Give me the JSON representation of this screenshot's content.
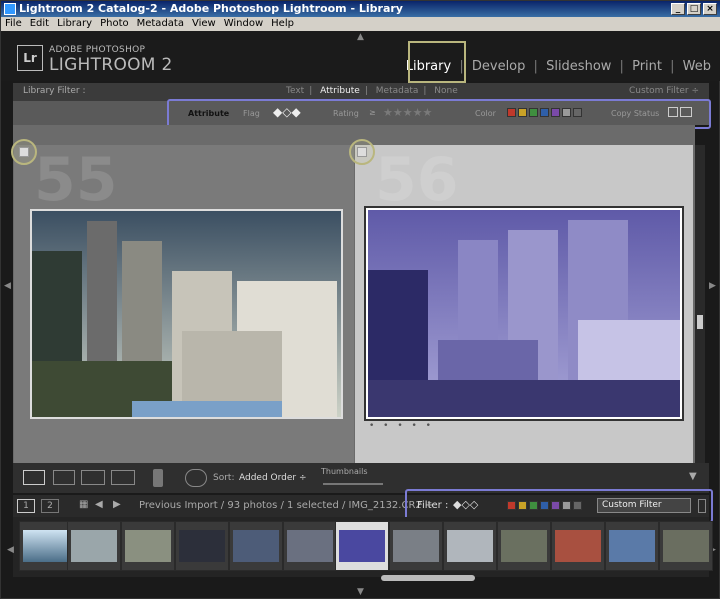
{
  "window": {
    "title": "Lightroom 2 Catalog-2 - Adobe Photoshop Lightroom - Library",
    "min": "_",
    "max": "□",
    "close": "×"
  },
  "menu": [
    "File",
    "Edit",
    "Library",
    "Photo",
    "Metadata",
    "View",
    "Window",
    "Help"
  ],
  "brand": {
    "logo": "Lr",
    "line1": "ADOBE PHOTOSHOP",
    "line2": "LIGHTROOM 2"
  },
  "modules": [
    "Library",
    "Develop",
    "Slideshow",
    "Print",
    "Web"
  ],
  "library_filter": {
    "label": "Library Filter :",
    "options": [
      "Text",
      "Attribute",
      "Metadata",
      "None"
    ],
    "active": "Attribute",
    "custom": "Custom Filter ÷"
  },
  "attribute_bar": {
    "attribute": "Attribute",
    "flag": "Flag",
    "rating": "Rating",
    "rating_op": "≥",
    "color": "Color",
    "copy_status": "Copy Status"
  },
  "color_labels": [
    "#c0392b",
    "#c9a227",
    "#3f8f3f",
    "#2f5fa8",
    "#7a4aa8",
    "#9a9a9a",
    "#666666"
  ],
  "grid": {
    "cell1_num": "55",
    "cell2_num": "56",
    "dots": "• • • • •"
  },
  "toolbar": {
    "sort_label": "Sort:",
    "sort_value": "Added Order ÷",
    "thumbnails": "Thumbnails"
  },
  "filmstrip_bar": {
    "page1": "1",
    "page2": "2",
    "path": "Previous Import / 93 photos / 1 selected / IMG_2132.CR2 ÷",
    "filter_label": "Filter :",
    "filter_value": "Custom Filter"
  }
}
